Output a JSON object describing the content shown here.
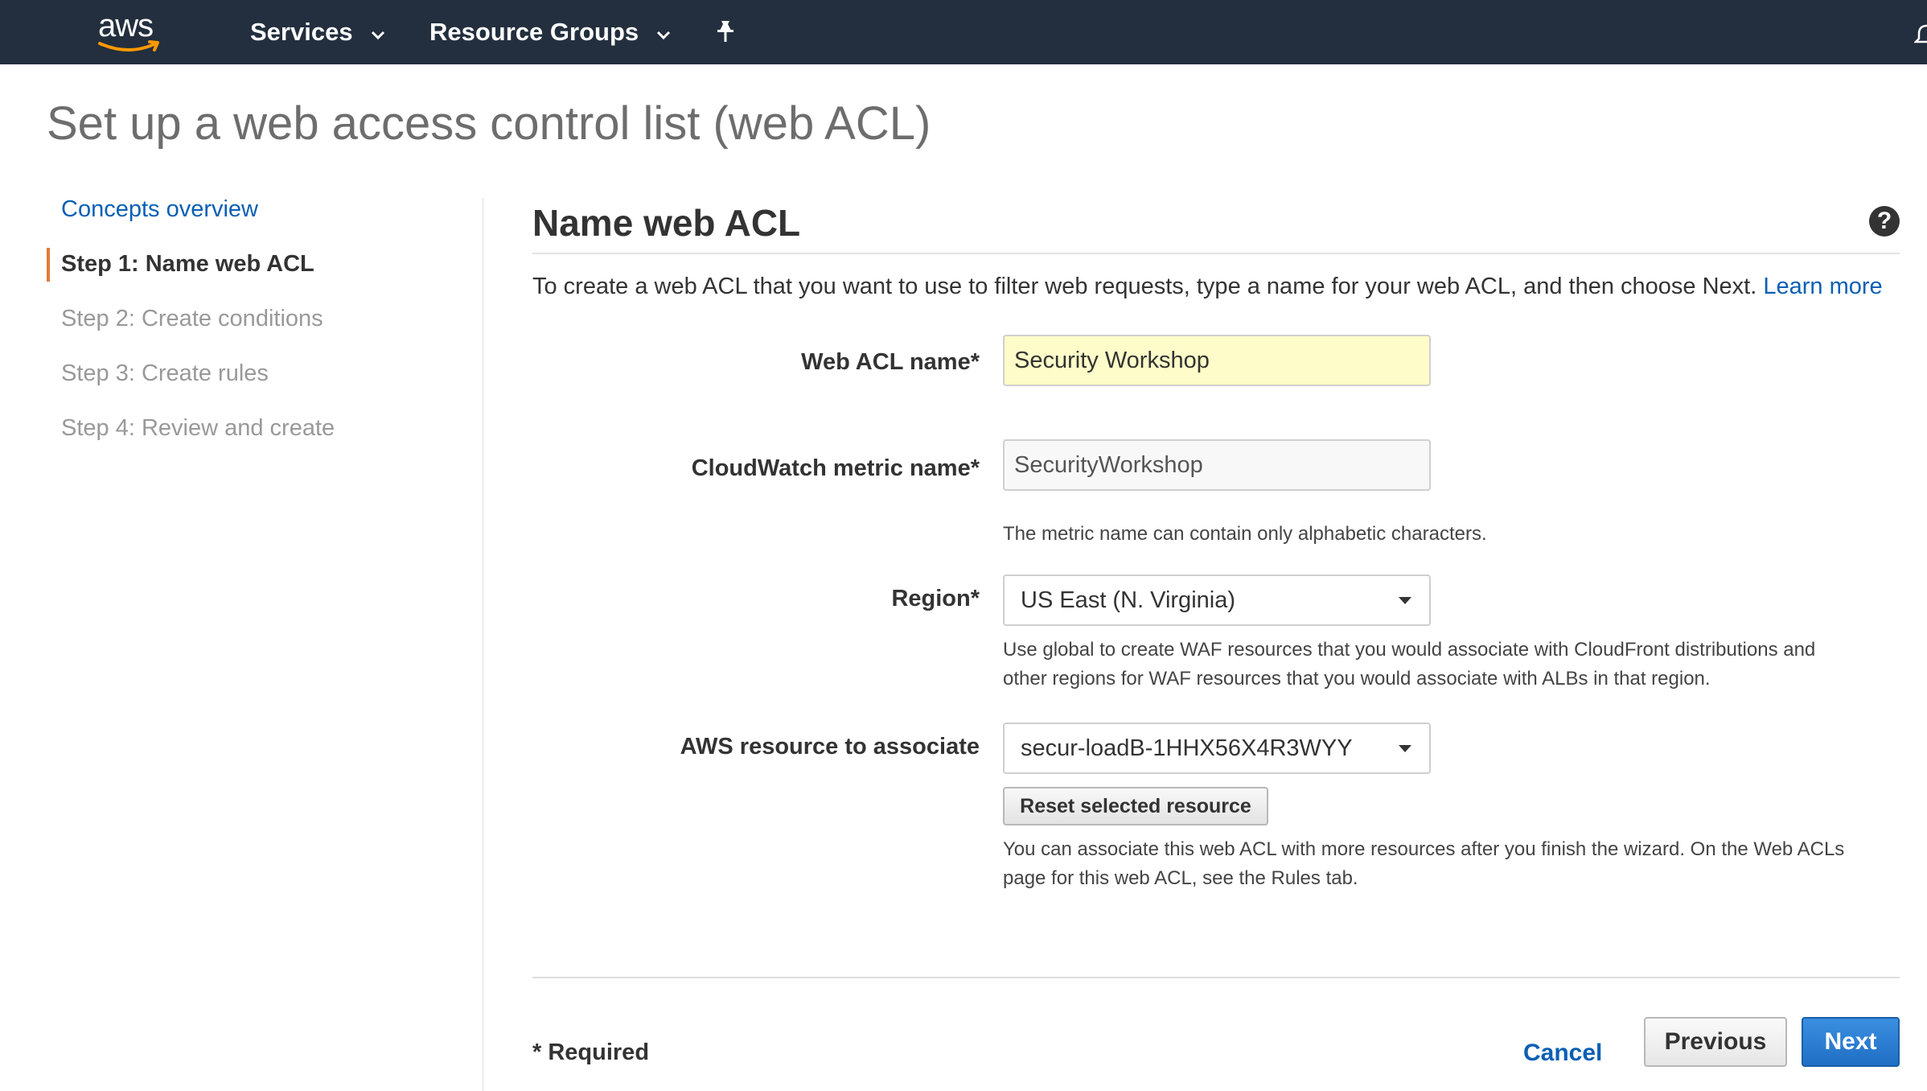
{
  "topnav": {
    "logo_text": "aws",
    "services_label": "Services",
    "resource_groups_label": "Resource Groups",
    "pin_icon": "pin-icon",
    "bell_icon": "bell-icon"
  },
  "page": {
    "title": "Set up a web access control list (web ACL)"
  },
  "sidebar": {
    "items": [
      {
        "label": "Concepts overview",
        "state": "link"
      },
      {
        "label": "Step 1: Name web ACL",
        "state": "active"
      },
      {
        "label": "Step 2: Create conditions",
        "state": "disabled"
      },
      {
        "label": "Step 3: Create rules",
        "state": "disabled"
      },
      {
        "label": "Step 4: Review and create",
        "state": "disabled"
      }
    ],
    "active_color": "#e07b39"
  },
  "main": {
    "section_title": "Name web ACL",
    "help_icon_glyph": "?",
    "intro_text": "To create a web ACL that you want to use to filter web requests, type a name for your web ACL, and then choose Next.",
    "learn_more": "Learn more",
    "fields": {
      "web_acl_name": {
        "label": "Web ACL name*",
        "value": "Security Workshop"
      },
      "cloudwatch_metric": {
        "label": "CloudWatch metric name*",
        "value": "SecurityWorkshop",
        "hint": "The metric name can contain only alphabetic characters."
      },
      "region": {
        "label": "Region*",
        "value": "US East (N. Virginia)",
        "hint_line1": "Use global to create WAF resources that you would associate with CloudFront distributions and",
        "hint_line2": "other regions for WAF resources that you would associate with ALBs in that region."
      },
      "resource": {
        "label": "AWS resource to associate",
        "value": "secur-loadB-1HHX56X4R3WYY",
        "reset_label": "Reset selected resource",
        "hint_line1": "You can associate this web ACL with more resources after you finish the wizard. On the Web ACLs",
        "hint_line2": "page for this web ACL, see the Rules tab."
      }
    },
    "required_note": "* Required",
    "buttons": {
      "cancel": "Cancel",
      "previous": "Previous",
      "next": "Next"
    }
  },
  "colors": {
    "nav_bg": "#232f3e",
    "link": "#0a5fb4",
    "name_field_bg": "#fefdc9",
    "primary_button": "#1f6fc5"
  }
}
